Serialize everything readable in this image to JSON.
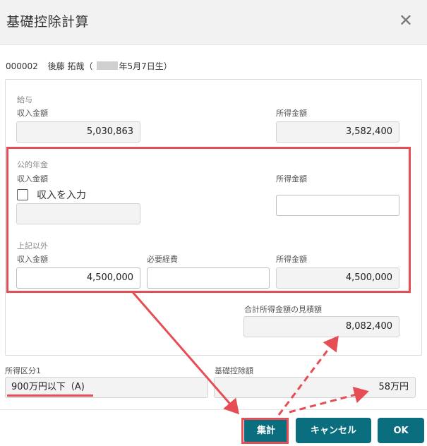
{
  "dialog": {
    "title": "基礎控除計算",
    "close_icon": "close-icon"
  },
  "person": {
    "id": "000002",
    "name": "後藤 拓哉",
    "birth_open": "（",
    "birth": "年5月7日生）"
  },
  "salary": {
    "section": "給与",
    "income_label": "収入金額",
    "income_value": "5,030,863",
    "earned_label": "所得金額",
    "earned_value": "3,582,400"
  },
  "pension": {
    "section": "公的年金",
    "income_label": "収入金額",
    "checkbox_label": "収入を入力",
    "checkbox_checked": false,
    "income_value": "",
    "earned_label": "所得金額",
    "earned_value": ""
  },
  "other": {
    "section": "上記以外",
    "income_label": "収入金額",
    "income_value": "4,500,000",
    "expense_label": "必要経費",
    "expense_value": "",
    "earned_label": "所得金額",
    "earned_value": "4,500,000"
  },
  "total": {
    "label": "合計所得金額の見積額",
    "value": "8,082,400"
  },
  "income_class": {
    "label": "所得区分1",
    "value": "900万円以下（A)"
  },
  "basic_deduction": {
    "label": "基礎控除額",
    "value": "58万円"
  },
  "buttons": {
    "aggregate": "集計",
    "cancel": "キャンセル",
    "ok": "OK"
  },
  "annotation_color": "#e64d55",
  "accent_color": "#0b6e7f"
}
